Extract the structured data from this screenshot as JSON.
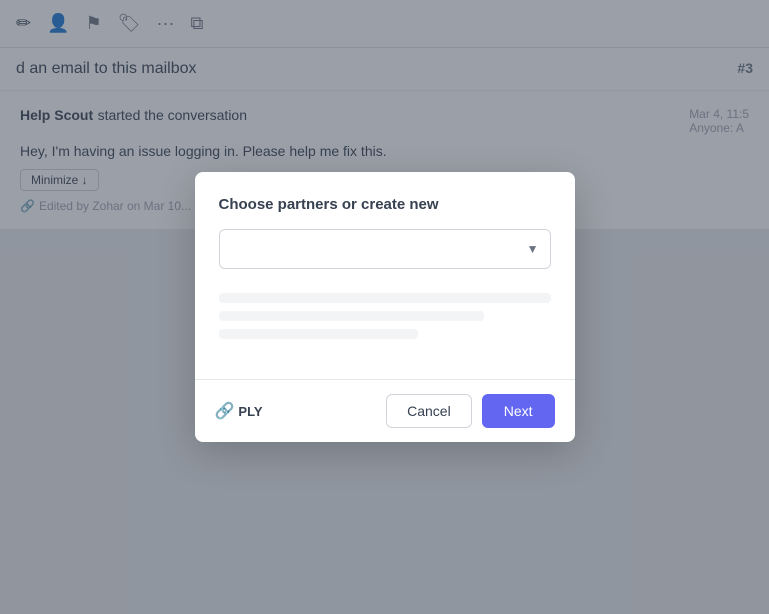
{
  "toolbar": {
    "icons": [
      {
        "name": "edit-icon",
        "symbol": "✏️"
      },
      {
        "name": "person-icon",
        "symbol": "👤"
      },
      {
        "name": "flag-icon",
        "symbol": "🚩"
      },
      {
        "name": "tag-icon",
        "symbol": "🏷️"
      },
      {
        "name": "more-icon",
        "symbol": "···"
      },
      {
        "name": "grid-icon",
        "symbol": "⧉"
      }
    ]
  },
  "conversation": {
    "title": "d an email to this mailbox",
    "number": "#3",
    "sender_name": "Help Scout",
    "sender_action": " started the conversation",
    "date": "Mar 4, 11:5",
    "recipient": "Anyone: A",
    "message_body": "Hey, I'm having an issue logging in. Please help me fix this.",
    "minimize_label": "Minimize ↓",
    "edited_note": "Edited by Zohar on Mar 10..."
  },
  "modal": {
    "title": "Choose partners or create new",
    "dropdown_placeholder": "",
    "logo_icon": "🔗",
    "logo_text": "PLY",
    "cancel_label": "Cancel",
    "next_label": "Next"
  }
}
